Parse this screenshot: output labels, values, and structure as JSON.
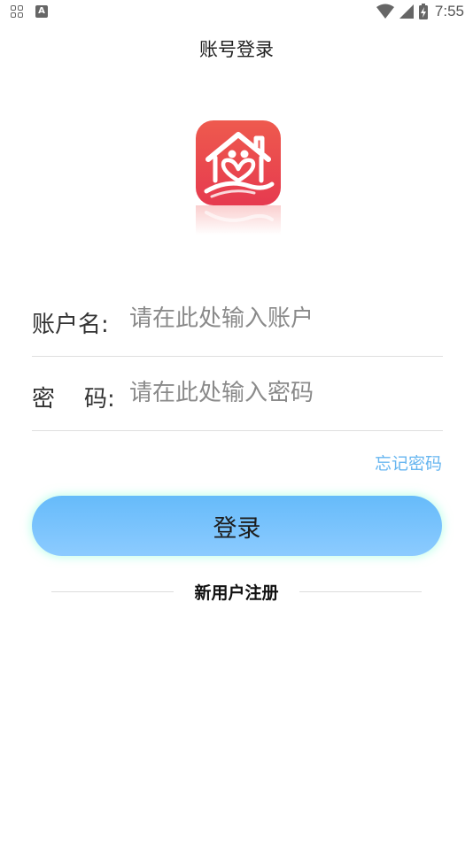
{
  "status_bar": {
    "time": "7:55",
    "icons": [
      "apps-icon",
      "font-a-icon",
      "wifi-icon",
      "cellular-signal-icon",
      "battery-icon"
    ]
  },
  "page": {
    "title": "账号登录"
  },
  "logo": {
    "icon": "home-heart-logo",
    "colors": {
      "gradient_top": "#ee5a4e",
      "gradient_bottom": "#e63a4f"
    }
  },
  "form": {
    "username": {
      "label": "账户名:",
      "placeholder": "请在此处输入账户",
      "value": ""
    },
    "password": {
      "label": "密    码:",
      "placeholder": "请在此处输入密码",
      "value": ""
    }
  },
  "actions": {
    "forgot_password": "忘记密码",
    "login": "登录",
    "register": "新用户注册"
  },
  "colors": {
    "accent_link": "#67b6f0",
    "button_top": "#66bbfa",
    "button_bottom": "#8ccbff",
    "button_glow": "#96ffdc"
  }
}
